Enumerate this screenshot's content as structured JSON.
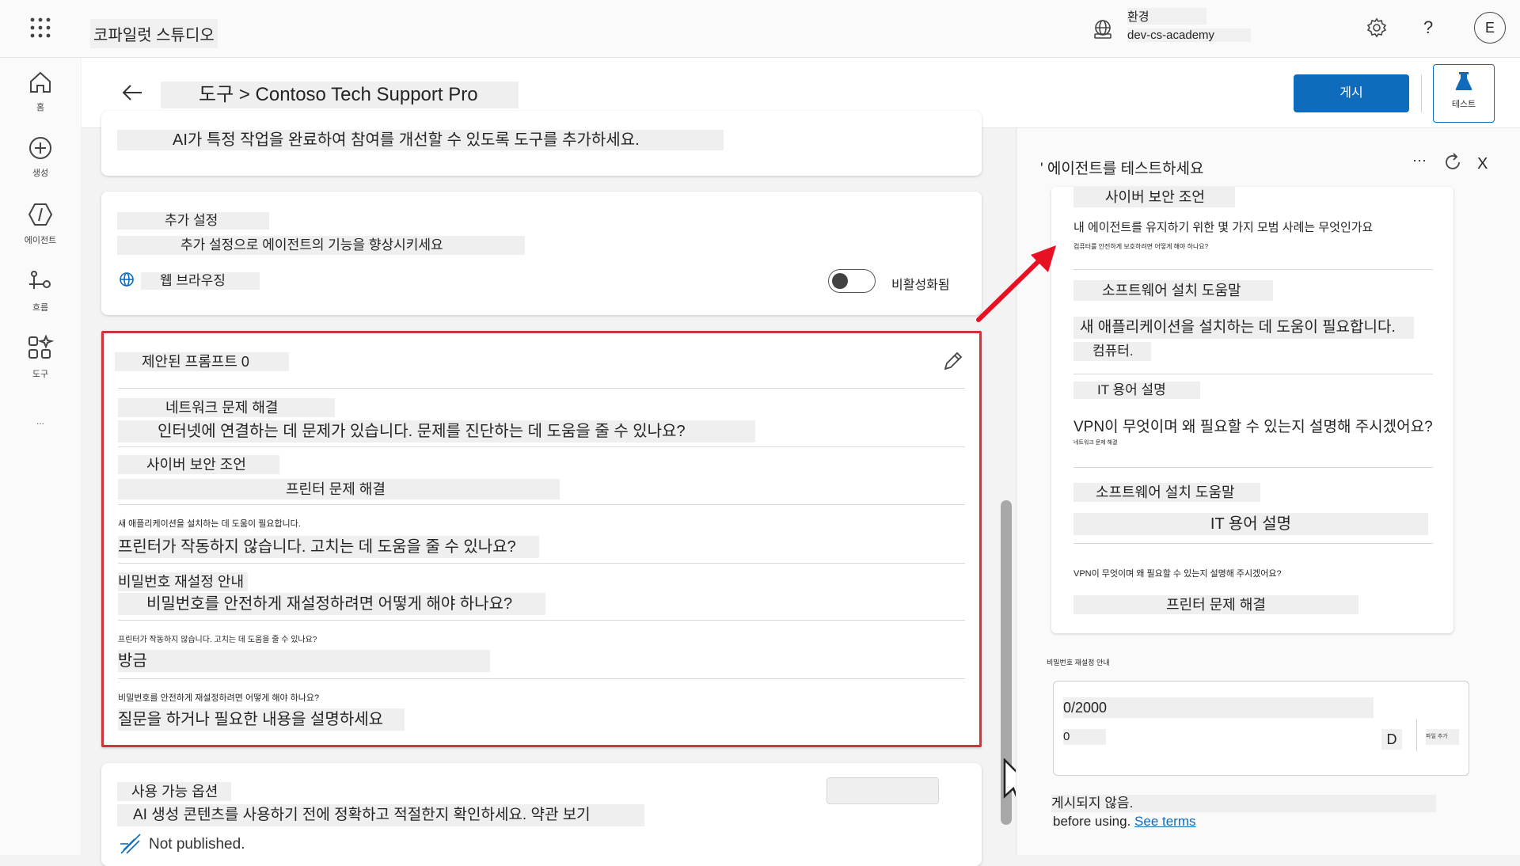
{
  "topbar": {
    "app_title": "코파일럿 스튜디오",
    "env_label": "환경",
    "env_value": "dev-cs-academy",
    "help_label": "?",
    "avatar_initial": "E"
  },
  "rail": {
    "home": "홈",
    "create": "생성",
    "agents": "에이전트",
    "flows": "흐름",
    "tools": "도구",
    "more": "..."
  },
  "header": {
    "breadcrumb": "도구 > Contoso Tech Support Pro",
    "publish_label": "게시",
    "test_label": "테스트"
  },
  "tools_card": {
    "description": "AI가 특정 작업을 완료하여 참여를 개선할 수 있도록 도구를 추가하세요."
  },
  "settings_card": {
    "title": "추가 설정",
    "subtitle": "추가 설정으로 에이전트의 기능을 향상시키세요",
    "web_browsing_label": "웹 브라우징",
    "toggle_status": "비활성화됨"
  },
  "prompts_card": {
    "title": "제안된 프롬프트 0",
    "items": [
      {
        "title": "네트워크 문제 해결",
        "text": "인터넷에 연결하는 데 문제가 있습니다. 문제를 진단하는 데 도움을 줄 수 있나요?"
      },
      {
        "title": "사이버 보안 조언",
        "text": "프린터 문제 해결"
      },
      {
        "title": "새 애플리케이션을 설치하는 데 도움이 필요합니다.",
        "text": "프린터가 작동하지 않습니다. 고치는 데 도움을 줄 수 있나요?"
      },
      {
        "title": "비밀번호 재설정 안내",
        "text": "비밀번호를 안전하게 재설정하려면 어떻게 해야 하나요?"
      },
      {
        "title": "프린터가 작동하지 않습니다. 고치는 데 도움을 줄 수 있나요?",
        "text": "방금"
      },
      {
        "title": "비밀번호를 안전하게 재설정하려면 어떻게 해야 하나요?",
        "text": "질문을 하거나 필요한 내용을 설명하세요"
      }
    ]
  },
  "options_card": {
    "title": "사용 가능 옵션",
    "text": "AI 생성 콘텐츠를 사용하기 전에 정확하고 적절한지 확인하세요. 약관 보기",
    "footer": "Not published."
  },
  "test_panel": {
    "title": "' 에이전트를 테스트하세요",
    "more_label": "···",
    "close_label": "X",
    "cards": [
      {
        "title": "사이버 보안 조언",
        "text": "내 에이전트를 유지하기 위한 몇 가지 모범 사례는 무엇인가요",
        "small": "컴퓨터를 안전하게 보호하려면 어떻게 해야 하나요?"
      },
      {
        "title": "소프트웨어 설치 도움말",
        "text": "새 애플리케이션을 설치하는 데 도움이 필요합니다.",
        "small": "컴퓨터."
      },
      {
        "title": "IT 용어 설명",
        "text": "VPN이 무엇이며 왜 필요할 수 있는지 설명해 주시겠어요?",
        "small": "네트워크 문제 해결"
      },
      {
        "title": "소프트웨어 설치 도움말",
        "text": "IT 용어 설명",
        "small": ""
      },
      {
        "title": "VPN이 무엇이며 왜 필요할 수 있는지 설명해 주시겠어요?",
        "text": "프린터 문제 해결",
        "small": ""
      }
    ],
    "below_card": "비밀번호 재설정 안내",
    "input_count": "0/2000",
    "input_value": "0",
    "send_label": "D",
    "attach_label": "파일 추가",
    "disclaimer_1": "게시되지 않음.",
    "disclaimer_2": "before using.",
    "terms_link": "See terms"
  },
  "colors": {
    "accent": "#0f6cbd",
    "highlight_border": "#d13438",
    "arrow": "#e81123"
  }
}
